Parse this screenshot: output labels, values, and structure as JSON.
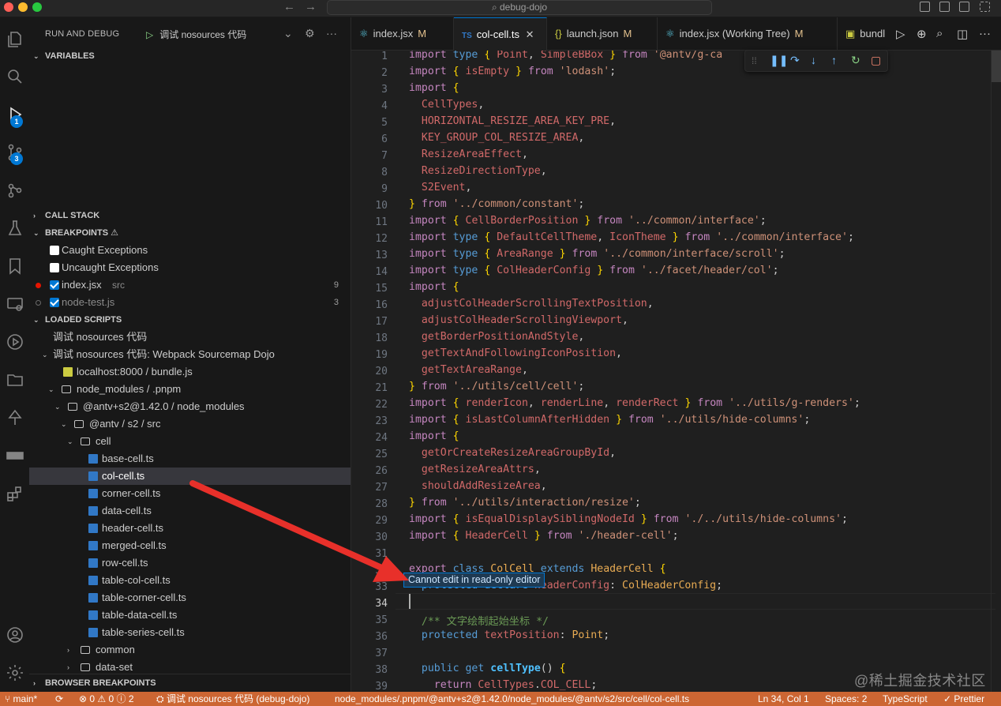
{
  "window": {
    "command_center": "debug-dojo"
  },
  "activity_bar": {
    "run_debug_badge": "1",
    "scm_badge": "3"
  },
  "sidebar": {
    "title": "RUN AND DEBUG",
    "launch_config": "调试 nosources 代码",
    "sections": {
      "variables": "VARIABLES",
      "call_stack": "CALL STACK",
      "breakpoints": "BREAKPOINTS",
      "loaded_scripts": "LOADED SCRIPTS",
      "browser_breakpoints": "BROWSER BREAKPOINTS"
    },
    "breakpoints": [
      {
        "label": "Caught Exceptions",
        "checked": false
      },
      {
        "label": "Uncaught Exceptions",
        "checked": false
      },
      {
        "label": "index.jsx",
        "detail": "src",
        "count": "9",
        "checked": true
      },
      {
        "label": "node-test.js",
        "detail": "",
        "count": "3",
        "checked": true
      }
    ],
    "loaded_scripts": [
      "调试 nosources 代码",
      "调试 nosources 代码: Webpack Sourcemap Dojo",
      "localhost:8000 / bundle.js",
      "node_modules / .pnpm",
      "@antv+s2@1.42.0 / node_modules",
      "@antv / s2 / src",
      "cell",
      "base-cell.ts",
      "col-cell.ts",
      "corner-cell.ts",
      "data-cell.ts",
      "header-cell.ts",
      "merged-cell.ts",
      "row-cell.ts",
      "table-col-cell.ts",
      "table-corner-cell.ts",
      "table-data-cell.ts",
      "table-series-cell.ts",
      "common",
      "data-set"
    ]
  },
  "tabs": [
    {
      "label": "index.jsx",
      "status": "M"
    },
    {
      "label": "col-cell.ts",
      "status": ""
    },
    {
      "label": "launch.json",
      "status": "M"
    },
    {
      "label": "index.jsx (Working Tree)",
      "status": "M"
    },
    {
      "label": "bundl",
      "status": ""
    }
  ],
  "editor": {
    "tooltip": "Cannot edit in read-only editor",
    "line_numbers": [
      "1",
      "2",
      "3",
      "4",
      "5",
      "6",
      "7",
      "8",
      "9",
      "10",
      "11",
      "12",
      "13",
      "14",
      "15",
      "16",
      "17",
      "18",
      "19",
      "20",
      "21",
      "22",
      "23",
      "24",
      "25",
      "26",
      "27",
      "28",
      "29",
      "30",
      "31",
      "32",
      "33",
      "34",
      "35",
      "36",
      "37",
      "38",
      "39"
    ]
  },
  "statusbar": {
    "branch": "main*",
    "problems": "⊗ 0 ⚠ 0 ⓘ 2",
    "debug_session": "调试 nosources 代码 (debug-dojo)",
    "file_path": "node_modules/.pnpm/@antv+s2@1.42.0/node_modules/@antv/s2/src/cell/col-cell.ts",
    "position": "Ln 34, Col 1",
    "spaces": "Spaces: 2",
    "language": "TypeScript",
    "formatter": "Prettier"
  },
  "watermark": "@稀土掘金技术社区",
  "colors": {
    "statusbar": "#cc6633",
    "accent": "#0078d4",
    "arrow": "#e8302a"
  }
}
